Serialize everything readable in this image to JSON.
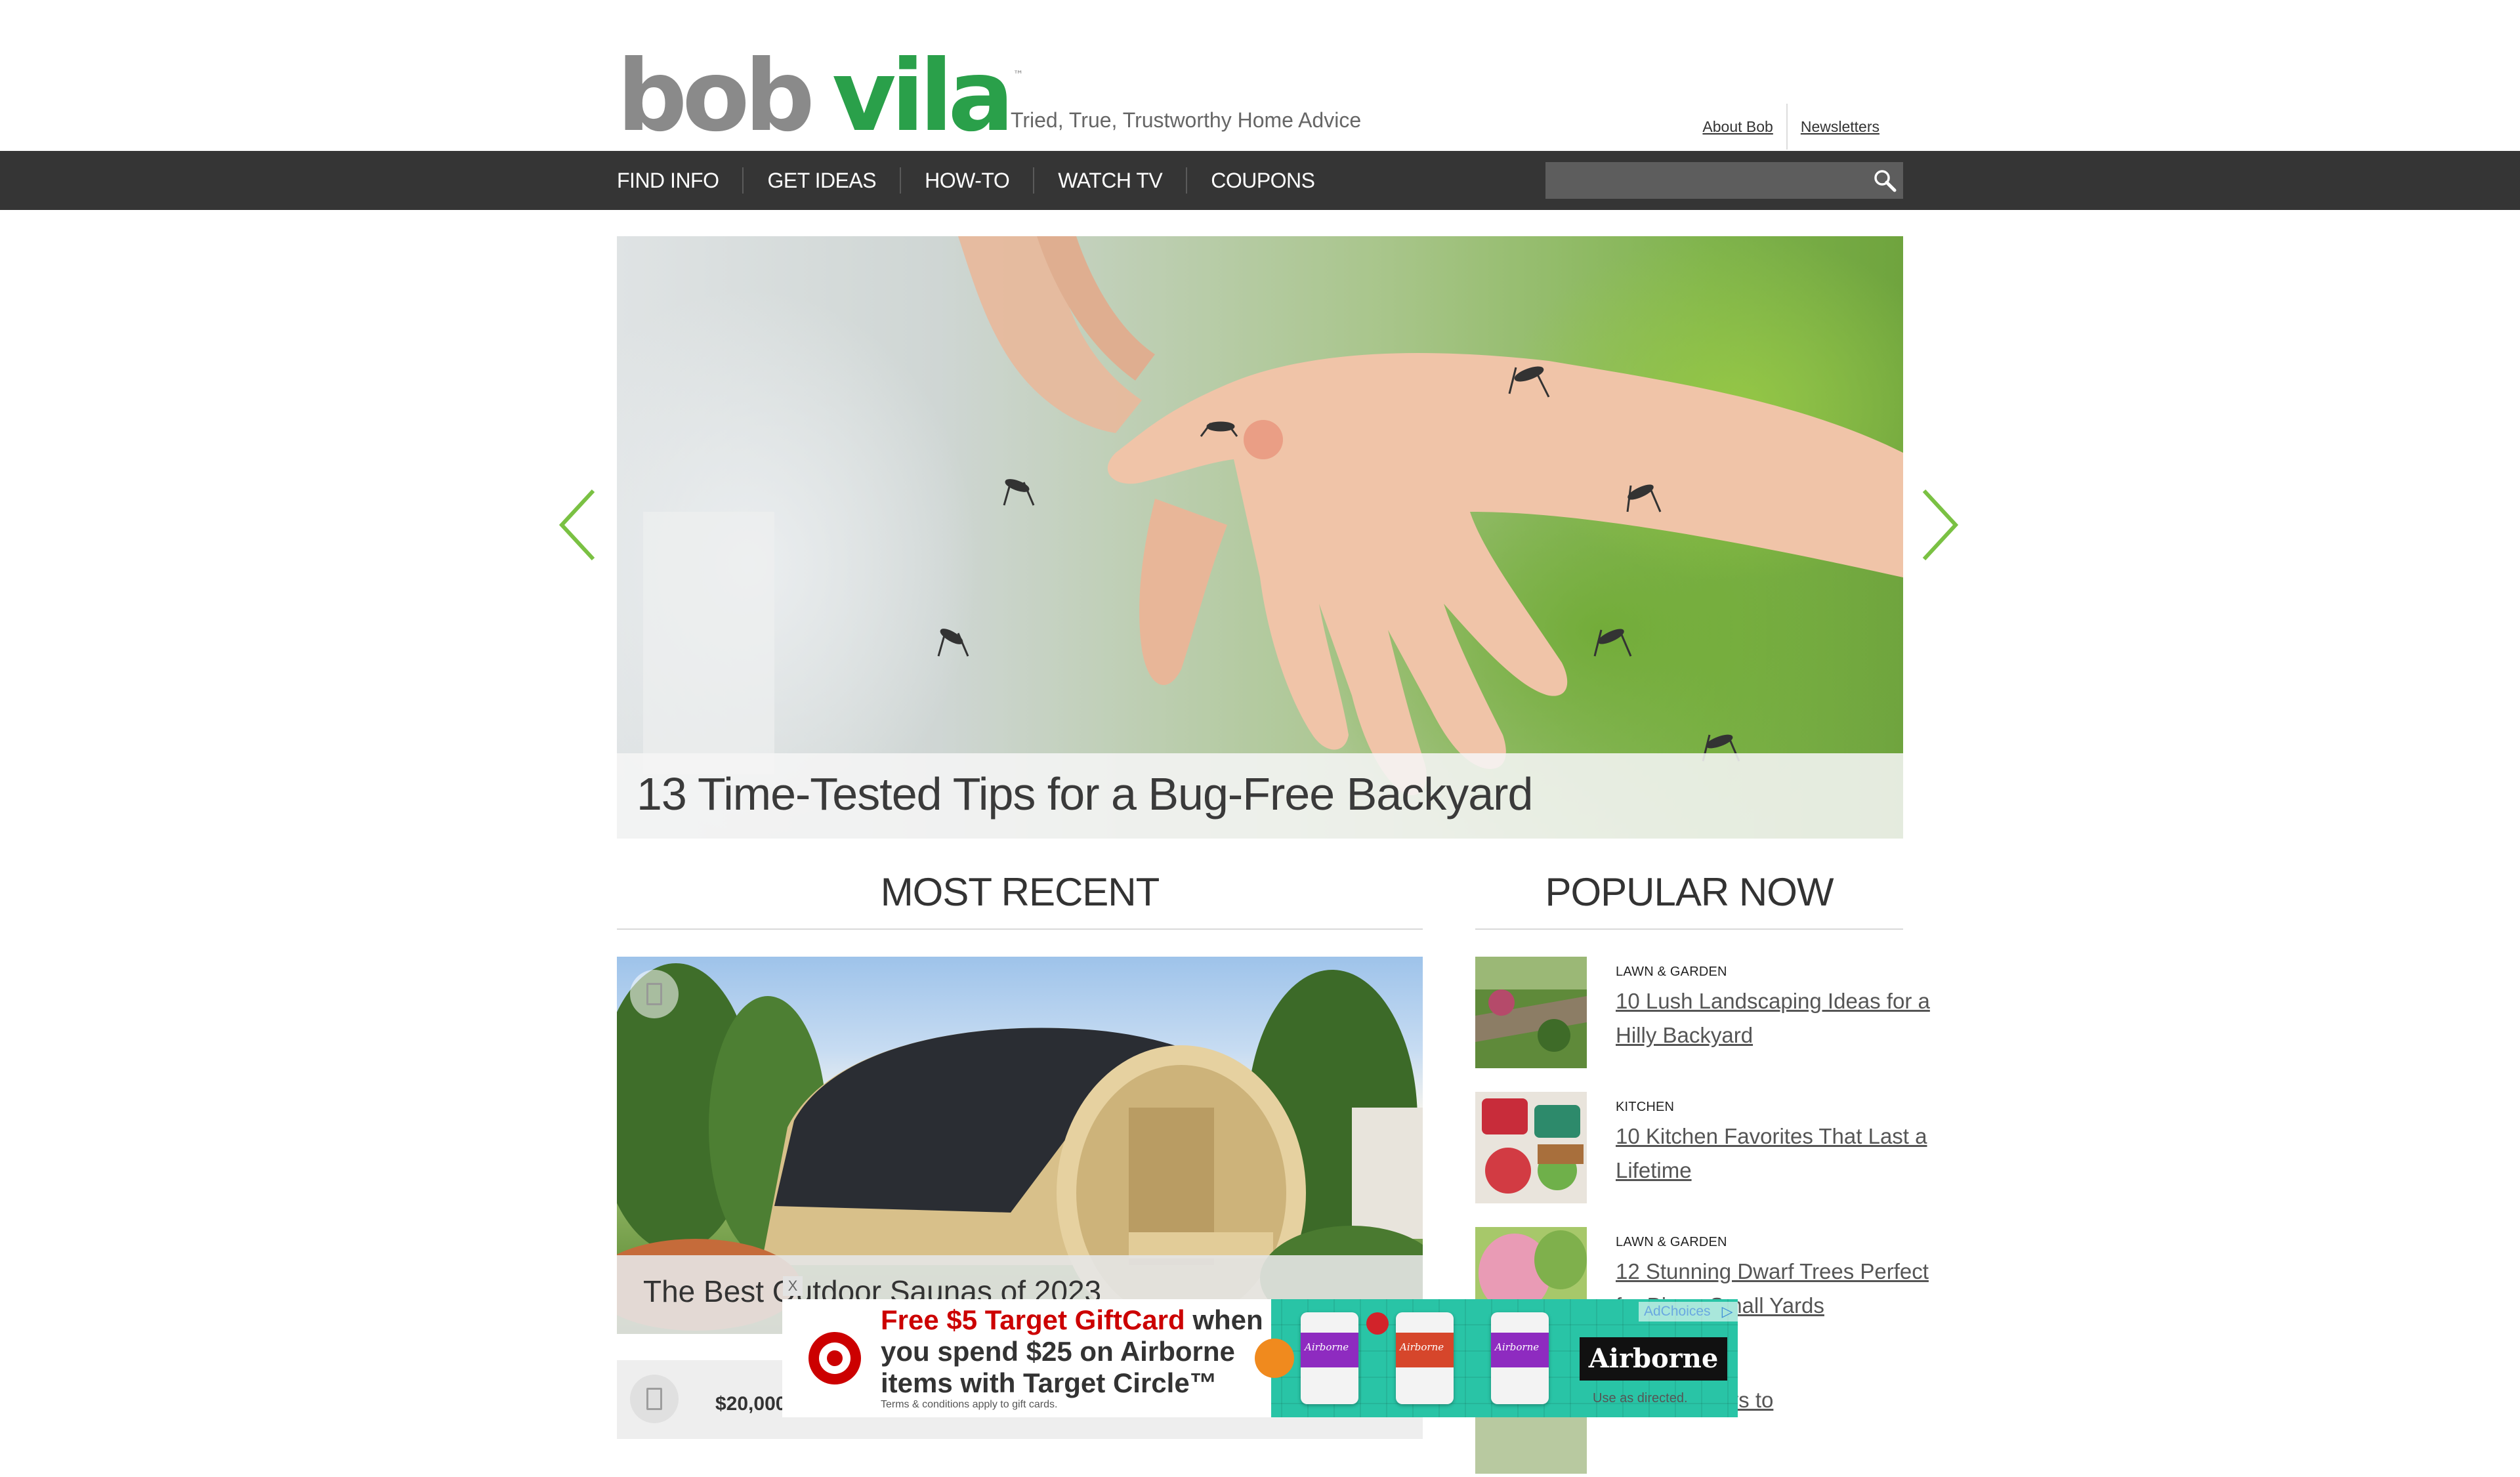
{
  "header": {
    "logo_bob": "bob",
    "logo_vila": "vila",
    "logo_tm": "™",
    "tagline": "Tried, True, Trustworthy Home Advice",
    "links": [
      "About Bob",
      "Newsletters"
    ]
  },
  "nav": {
    "items": [
      "FIND INFO",
      "GET IDEAS",
      "HOW-TO",
      "WATCH TV",
      "COUPONS"
    ],
    "search_placeholder": ""
  },
  "hero": {
    "caption": "13 Time-Tested Tips for a Bug-Free Backyard"
  },
  "most_recent": {
    "title": "MOST RECENT",
    "card1_title": "The Best Outdoor Saunas of 2023",
    "card2_price": "$20,000"
  },
  "popular_now": {
    "title": "POPULAR NOW",
    "items": [
      {
        "category": "LAWN & GARDEN",
        "title": "10 Lush Landscaping Ideas for a Hilly Backyard"
      },
      {
        "category": "KITCHEN",
        "title": "10 Kitchen Favorites That Last a Lifetime"
      },
      {
        "category": "LAWN & GARDEN",
        "title": "12 Stunning Dwarf Trees Perfect for Big or Small Yards"
      },
      {
        "category": "",
        "title": "spiring Ways to"
      }
    ]
  },
  "ad": {
    "line1_red": "Free $5 Target GiftCard",
    "line1_rest": " when",
    "line2": "you spend $25 on Airborne",
    "line3": "items with Target Circle™",
    "terms": "Terms & conditions apply to gift cards.",
    "brand": "Airborne",
    "use": "Use as directed.",
    "bottle_label": "Airborne",
    "adchoices": "AdChoices",
    "close": "X"
  },
  "colors": {
    "brand_green": "#2aa04a",
    "nav_bg": "#353535",
    "arrow_green": "#7ac143",
    "target_red": "#cc0000"
  },
  "icons": [
    "search-icon",
    "chevron-left-icon",
    "chevron-right-icon",
    "gallery-icon",
    "target-logo",
    "adchoices-icon"
  ]
}
